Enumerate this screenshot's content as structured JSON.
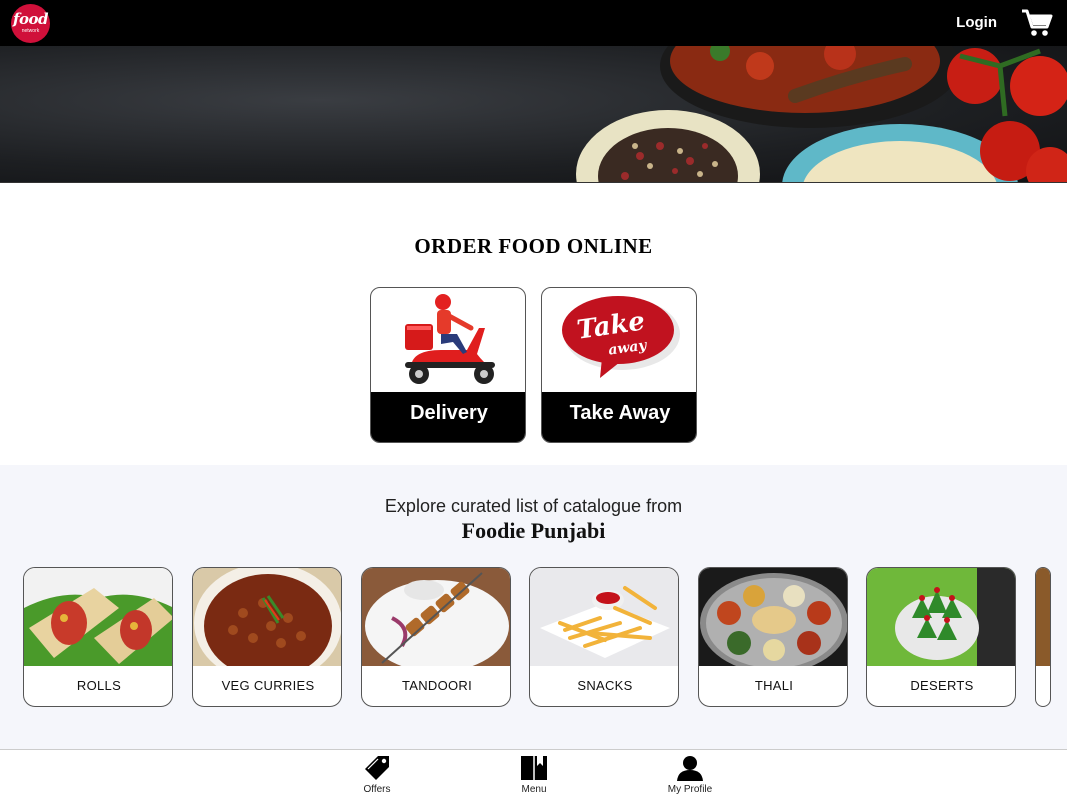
{
  "header": {
    "logo_line1": "food",
    "logo_line2": "network",
    "login_label": "Login",
    "cart_icon": "cart-icon"
  },
  "hero": {
    "slide_count": 4,
    "active_slide": 3
  },
  "order": {
    "title": "ORDER FOOD ONLINE",
    "options": [
      {
        "label": "Delivery",
        "icon": "scooter-delivery-icon"
      },
      {
        "label": "Take Away",
        "icon": "take-away-bubble-icon"
      }
    ]
  },
  "catalogue": {
    "subtitle": "Explore curated list of catalogue from",
    "restaurant": "Foodie Punjabi",
    "categories": [
      {
        "label": "ROLLS"
      },
      {
        "label": "VEG CURRIES"
      },
      {
        "label": "TANDOORI"
      },
      {
        "label": "SNACKS"
      },
      {
        "label": "THALI"
      },
      {
        "label": "DESERTS"
      }
    ]
  },
  "bottom_nav": {
    "items": [
      {
        "label": "Offers",
        "icon": "tag-icon"
      },
      {
        "label": "Menu",
        "icon": "book-icon"
      },
      {
        "label": "My Profile",
        "icon": "person-icon"
      }
    ]
  },
  "colors": {
    "brand_red": "#d0103a",
    "topbar": "#000000",
    "catalogue_bg": "#f5f6fb"
  }
}
